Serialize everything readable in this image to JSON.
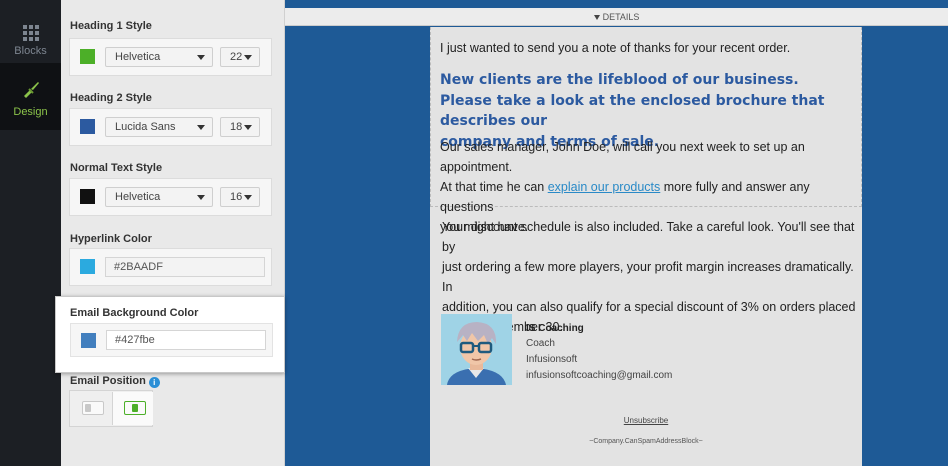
{
  "rail": {
    "blocks_label": "Blocks",
    "design_label": "Design"
  },
  "panel": {
    "h1": {
      "title": "Heading 1 Style",
      "color": "#4caf28",
      "font": "Helvetica",
      "size": "22"
    },
    "h2": {
      "title": "Heading 2 Style",
      "color": "#2c5aa0",
      "font": "Lucida Sans",
      "size": "18"
    },
    "normal": {
      "title": "Normal Text Style",
      "color": "#111111",
      "font": "Helvetica",
      "size": "16"
    },
    "hyperlink": {
      "title": "Hyperlink Color",
      "color": "#2BAADF",
      "value": "#2BAADF"
    },
    "email_bg": {
      "title": "Email Background Color",
      "color": "#427fbe",
      "value": "#427fbe"
    },
    "position": {
      "title": "Email Position",
      "selected": "right"
    }
  },
  "canvas": {
    "details_label": "DETAILS",
    "bg_color": "#1e5a96"
  },
  "email": {
    "intro": "I just wanted to send you a note of thanks for your recent order.",
    "heading_lines": [
      "New clients are the lifeblood of our business.",
      "Please take a look at the enclosed brochure that describes our",
      "company and terms of sale."
    ],
    "para1_before": "Our sales manager, John Doe, will call you next week to set up an appointment.",
    "para1_line2_before": "At that time he can ",
    "para1_link": "explain our products",
    "para1_line2_after": " more fully and answer any questions",
    "para1_line3": "you might have.",
    "para2_lines": [
      "Your discount schedule is also included. Take a careful look. You'll see that by",
      "just ordering a few more players, your profit margin increases dramatically. In",
      "addition, you can also qualify for a special discount of 3% on orders placed",
      "before September 30."
    ],
    "signature": {
      "name": "IS Coaching",
      "role": "Coach",
      "company": "Infusionsoft",
      "email": "infusionsoftcoaching@gmail.com"
    },
    "unsubscribe": "Unsubscribe",
    "footer": "~Company.CanSpamAddressBlock~"
  }
}
